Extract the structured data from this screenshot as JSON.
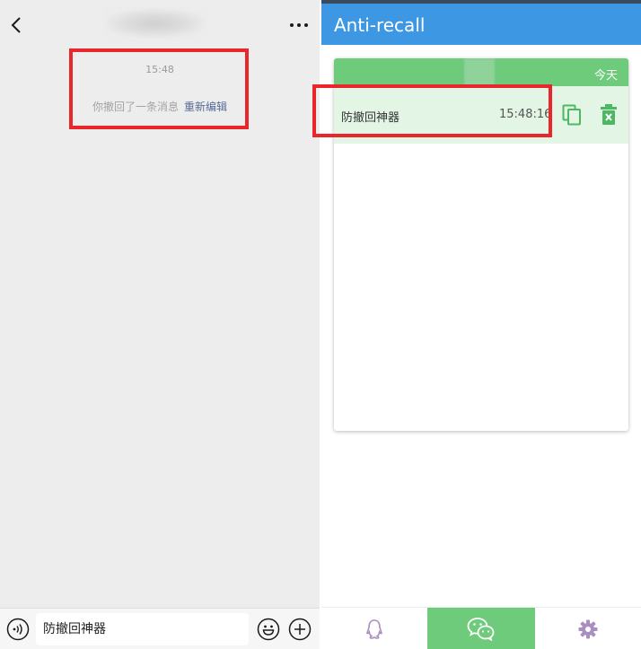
{
  "chat": {
    "timestamp": "15:48",
    "recall_notice": "你撤回了一条消息",
    "re_edit_link": "重新编辑",
    "input_value": "防撤回神器"
  },
  "app": {
    "title": "Anti-recall",
    "group": {
      "date_label": "今天",
      "message": {
        "text": "防撤回神器",
        "time": "15:48:16"
      }
    },
    "nav": [
      {
        "icon": "qq-penguin-icon",
        "active": false
      },
      {
        "icon": "wechat-icon",
        "active": true
      },
      {
        "icon": "gear-icon",
        "active": false
      }
    ]
  },
  "colors": {
    "app_bar": "#3d97e2",
    "accent_green": "#6ecb7c",
    "row_highlight": "#e3f5e5",
    "annotation_red": "#e8262c",
    "link_blue": "#576b95"
  }
}
